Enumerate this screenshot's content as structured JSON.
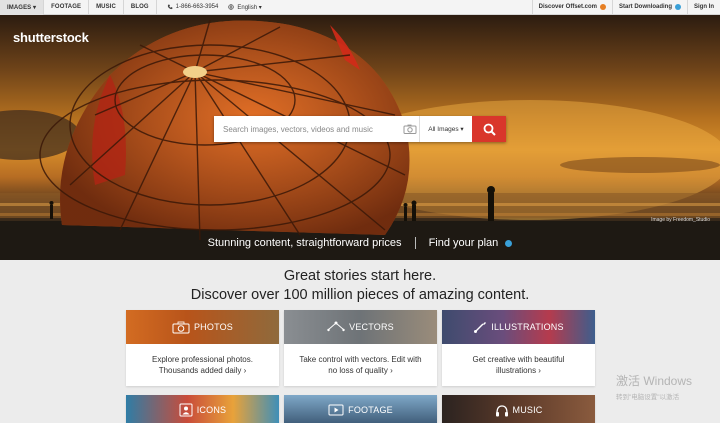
{
  "topbar": {
    "nav": [
      "IMAGES ▾",
      "FOOTAGE",
      "MUSIC",
      "BLOG"
    ],
    "phone": "1-866-663-3954",
    "language": "English ▾",
    "discover_offset": "Discover Offset.com",
    "start_downloading": "Start Downloading",
    "sign_in": "Sign In"
  },
  "hero": {
    "logo": "shutterstock",
    "search_placeholder": "Search images, vectors, videos and music",
    "search_scope": "All Images ▾",
    "image_credit": "Image by Freedom_Studio",
    "tagline": "Stunning content, straightforward prices",
    "find_plan": "Find your plan"
  },
  "headline": {
    "line1": "Great stories start here.",
    "line2": "Discover over 100 million pieces of amazing content."
  },
  "categories": [
    {
      "title": "PHOTOS",
      "desc": "Explore professional photos. Thousands added daily ›"
    },
    {
      "title": "VECTORS",
      "desc": "Take control with vectors. Edit with no loss of quality ›"
    },
    {
      "title": "ILLUSTRATIONS",
      "desc": "Get creative with beautiful illustrations ›"
    },
    {
      "title": "ICONS"
    },
    {
      "title": "FOOTAGE"
    },
    {
      "title": "MUSIC"
    }
  ],
  "watermark": {
    "line1": "激活 Windows",
    "line2": "转到\"电脑设置\"以激活"
  },
  "colors": {
    "accent_red": "#d9362b",
    "offset_orange": "#e67e22",
    "download_blue": "#3aa0d8"
  }
}
